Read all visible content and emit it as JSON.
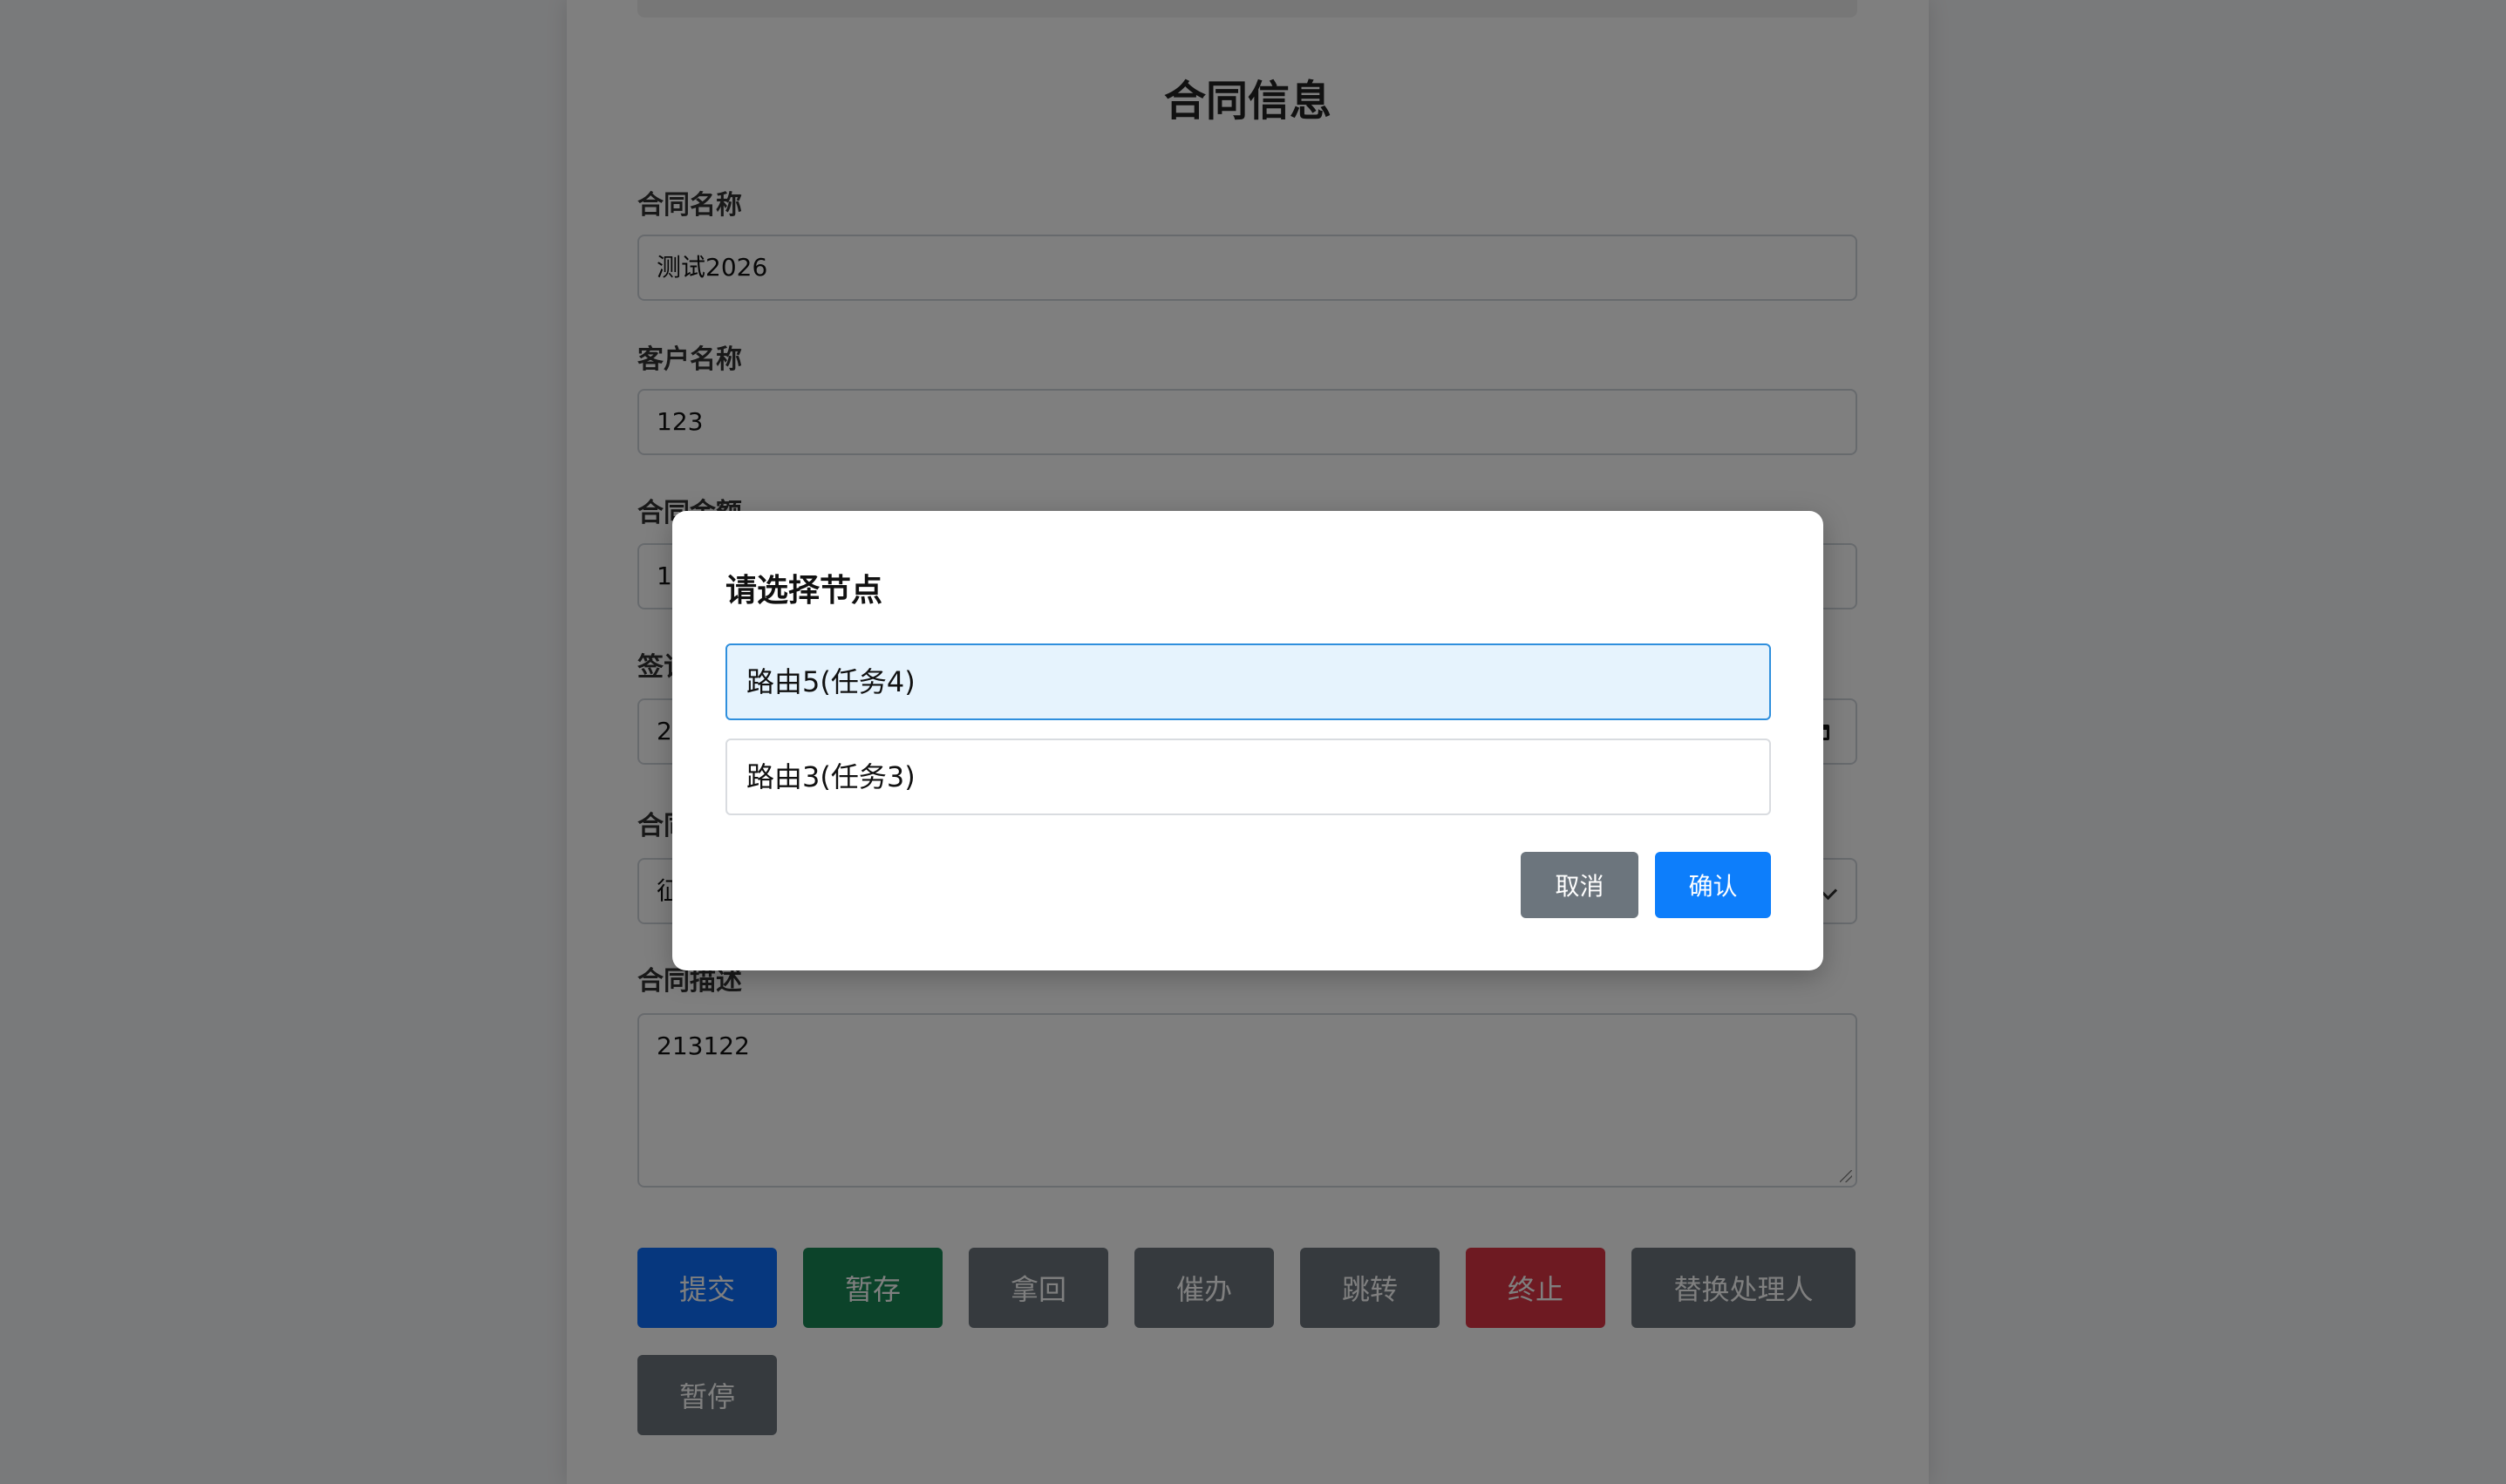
{
  "page": {
    "title": "合同信息",
    "fields": {
      "contract_name": {
        "label": "合同名称",
        "value": "测试2026"
      },
      "customer_name": {
        "label": "客户名称",
        "value": "123"
      },
      "contract_amount": {
        "label": "合同金额",
        "value": "1"
      },
      "sign_date": {
        "label": "签订日期",
        "value": "2"
      },
      "contract_type": {
        "label": "合同类型",
        "value": "征"
      },
      "contract_desc": {
        "label": "合同描述",
        "value": "213122"
      }
    },
    "actions": {
      "submit": "提交",
      "save_draft": "暂存",
      "retrieve": "拿回",
      "urge": "催办",
      "jump": "跳转",
      "terminate": "终止",
      "replace_handler": "替换处理人",
      "pause": "暂停"
    },
    "colors": {
      "primary": "#0d6efd",
      "success": "#198754",
      "secondary": "#6c757d",
      "danger": "#dc3545"
    }
  },
  "modal": {
    "title": "请选择节点",
    "options": [
      {
        "label": "路由5(任务4)",
        "selected": true
      },
      {
        "label": "路由3(任务3)",
        "selected": false
      }
    ],
    "cancel_label": "取消",
    "confirm_label": "确认",
    "colors": {
      "selected_bg": "#e6f3fd",
      "selected_border": "#2f8fdd",
      "confirm": "#0d7efb"
    }
  }
}
